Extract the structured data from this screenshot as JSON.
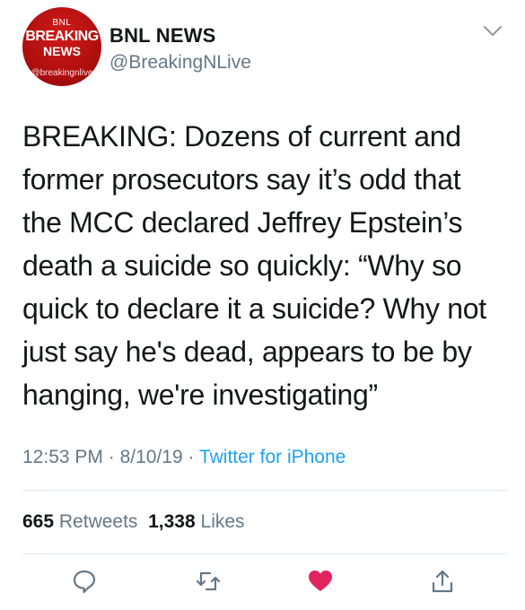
{
  "author": {
    "name": "BNL NEWS",
    "handle": "@BreakingNLive",
    "avatar": {
      "top_text": "BNL",
      "line1": "BREAKING",
      "line2": "NEWS",
      "bottom_text": "@breakingnlive"
    }
  },
  "tweet": {
    "lines": [
      "BREAKING: Dozens of current and",
      "former prosecutors say it’s odd that",
      "the MCC declared Jeffrey Epstein’s",
      "death a suicide so quickly: “Why so",
      "quick to declare it a suicide? Why not",
      "just say he's dead, appears to be by",
      "hanging, we're investigating”"
    ]
  },
  "meta": {
    "time": "12:53 PM",
    "sep1": " · ",
    "date": "8/10/19",
    "sep2": " · ",
    "source": "Twitter for iPhone"
  },
  "stats": {
    "retweets_count": "665",
    "retweets_label": "Retweets",
    "likes_count": "1,338",
    "likes_label": "Likes"
  },
  "icons": {
    "reply": "reply-icon",
    "retweet": "retweet-icon",
    "like": "heart-icon",
    "share": "share-icon",
    "menu": "chevron-down-icon"
  },
  "colors": {
    "text": "#14171a",
    "secondary": "#657786",
    "link": "#1da1f2",
    "like": "#e0245e",
    "avatar_red": "#c41414"
  }
}
